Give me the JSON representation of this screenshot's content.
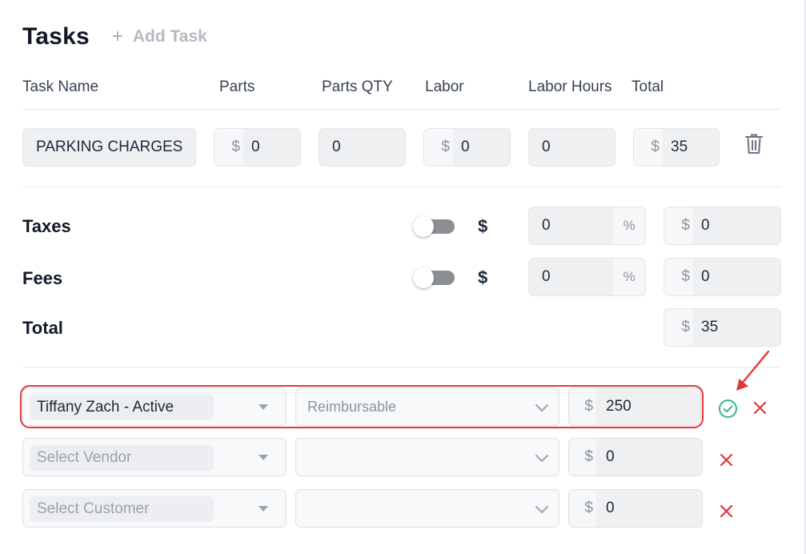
{
  "header": {
    "title": "Tasks",
    "add_task": "Add Task"
  },
  "columns": [
    "Task Name",
    "Parts",
    "Parts QTY",
    "Labor",
    "Labor Hours",
    "Total"
  ],
  "task": {
    "name": "PARKING CHARGES",
    "parts_prefix": "$",
    "parts": "0",
    "parts_qty": "0",
    "labor_prefix": "$",
    "labor": "0",
    "labor_hours": "0",
    "total_prefix": "$",
    "total": "35"
  },
  "summary": {
    "taxes": {
      "label": "Taxes",
      "currency": "$",
      "rate": "0",
      "rate_unit": "%",
      "amount_prefix": "$",
      "amount": "0",
      "toggle_on": false
    },
    "fees": {
      "label": "Fees",
      "currency": "$",
      "rate": "0",
      "rate_unit": "%",
      "amount_prefix": "$",
      "amount": "0",
      "toggle_on": false
    },
    "total": {
      "label": "Total",
      "amount_prefix": "$",
      "amount": "35"
    }
  },
  "allocations": [
    {
      "party": "Tiffany Zach - Active",
      "party_is_placeholder": false,
      "type": "Reimbursable",
      "amount_prefix": "$",
      "amount": "250",
      "confirm_icon": "check-circle-icon",
      "remove_icon": "close-icon"
    },
    {
      "party": "Select Vendor",
      "party_is_placeholder": true,
      "type": "",
      "amount_prefix": "$",
      "amount": "0",
      "remove_icon": "close-icon"
    },
    {
      "party": "Select Customer",
      "party_is_placeholder": true,
      "type": "",
      "amount_prefix": "$",
      "amount": "0",
      "remove_icon": "close-icon"
    }
  ],
  "colors": {
    "accent_red": "#e0383b",
    "confirm_green": "#3cb48a",
    "field_bg": "#eef0f2"
  }
}
